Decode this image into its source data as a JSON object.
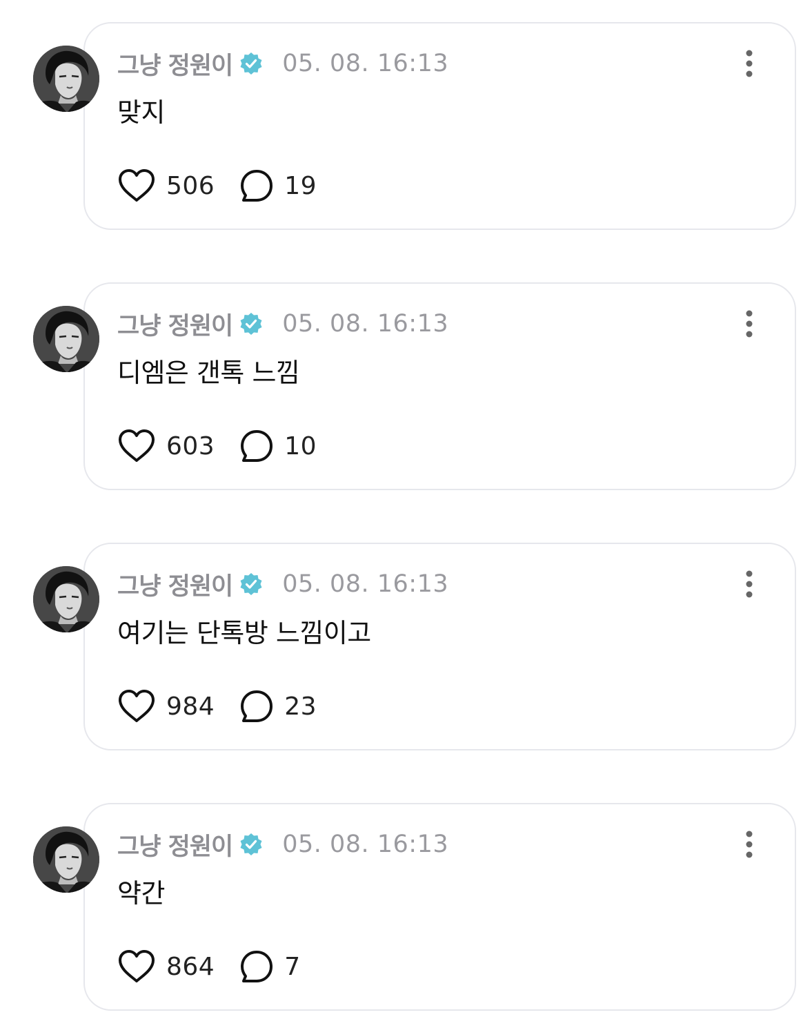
{
  "posts": [
    {
      "author": "그냥 정원이",
      "timestamp": "05. 08. 16:13",
      "text": "맞지",
      "likes": "506",
      "replies": "19"
    },
    {
      "author": "그냥 정원이",
      "timestamp": "05. 08. 16:13",
      "text": "디엠은 갠톡 느낌",
      "likes": "603",
      "replies": "10"
    },
    {
      "author": "그냥 정원이",
      "timestamp": "05. 08. 16:13",
      "text": "여기는 단톡방 느낌이고",
      "likes": "984",
      "replies": "23"
    },
    {
      "author": "그냥 정원이",
      "timestamp": "05. 08. 16:13",
      "text": "약간",
      "likes": "864",
      "replies": "7"
    }
  ],
  "icons": {
    "verified": "verified-badge-icon",
    "more": "more-vertical-icon",
    "like": "heart-icon",
    "reply": "speech-bubble-icon"
  },
  "colors": {
    "verified_badge": "#5ec2d6",
    "card_border": "#e6e7ec",
    "meta_text": "#8e8e93",
    "body_text": "#111111"
  }
}
